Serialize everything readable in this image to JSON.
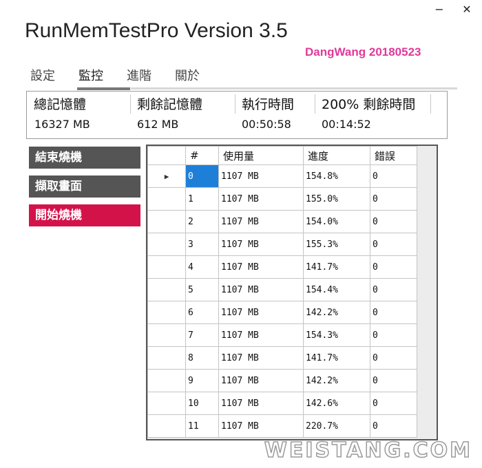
{
  "window": {
    "minimize_label": "−",
    "close_label": "✕"
  },
  "app": {
    "title": "RunMemTestPro Version 3.5",
    "author": "DangWang  20180523",
    "author_color": "#e0399b"
  },
  "tabs": [
    {
      "label": "設定",
      "active": false
    },
    {
      "label": "監控",
      "active": true
    },
    {
      "label": "進階",
      "active": false
    },
    {
      "label": "關於",
      "active": false
    }
  ],
  "colors": {
    "tab_active_underline": "#777777",
    "button_gray": "#555555",
    "button_red": "#d4124a",
    "selection_blue": "#1e7fd8"
  },
  "stats": {
    "total_memory": {
      "label": "總記憶體",
      "value": "16327 MB"
    },
    "free_memory": {
      "label": "剩餘記憶體",
      "value": "612 MB"
    },
    "elapsed_time": {
      "label": "執行時間",
      "value": "00:50:58"
    },
    "remaining_time": {
      "label": "200% 剩餘時間",
      "value": "00:14:52"
    }
  },
  "buttons": {
    "stop_burn": "結束燒機",
    "capture_screen": "擷取畫面",
    "start_burn": "開始燒機"
  },
  "grid": {
    "columns": [
      "#",
      "使用量",
      "進度",
      "錯誤"
    ],
    "current_row_marker": "▶",
    "rows": [
      {
        "id": "0",
        "usage": "1107 MB",
        "progress": "154.8%",
        "errors": "0"
      },
      {
        "id": "1",
        "usage": "1107 MB",
        "progress": "155.0%",
        "errors": "0"
      },
      {
        "id": "2",
        "usage": "1107 MB",
        "progress": "154.0%",
        "errors": "0"
      },
      {
        "id": "3",
        "usage": "1107 MB",
        "progress": "155.3%",
        "errors": "0"
      },
      {
        "id": "4",
        "usage": "1107 MB",
        "progress": "141.7%",
        "errors": "0"
      },
      {
        "id": "5",
        "usage": "1107 MB",
        "progress": "154.4%",
        "errors": "0"
      },
      {
        "id": "6",
        "usage": "1107 MB",
        "progress": "142.2%",
        "errors": "0"
      },
      {
        "id": "7",
        "usage": "1107 MB",
        "progress": "154.3%",
        "errors": "0"
      },
      {
        "id": "8",
        "usage": "1107 MB",
        "progress": "141.7%",
        "errors": "0"
      },
      {
        "id": "9",
        "usage": "1107 MB",
        "progress": "142.2%",
        "errors": "0"
      },
      {
        "id": "10",
        "usage": "1107 MB",
        "progress": "142.6%",
        "errors": "0"
      },
      {
        "id": "11",
        "usage": "1107 MB",
        "progress": "220.7%",
        "errors": "0"
      }
    ]
  },
  "watermark": "WEISTANG.COM"
}
